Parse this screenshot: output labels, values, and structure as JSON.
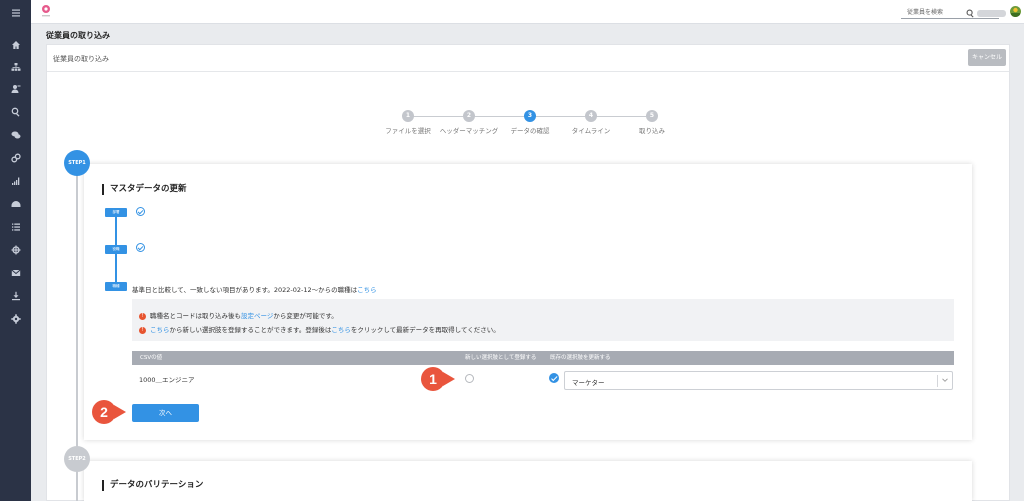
{
  "sidebar": {
    "icons": [
      "menu-icon",
      "home-icon",
      "org-chart-icon",
      "user-edit-icon",
      "search-icon",
      "chat-icon",
      "link-icon",
      "bar-chart-icon",
      "dashboard-icon",
      "list-icon",
      "target-icon",
      "mail-icon",
      "download-icon",
      "settings-icon"
    ]
  },
  "header": {
    "search_placeholder": "従業員を検索"
  },
  "page": {
    "title": "従業員の取り込み"
  },
  "panel": {
    "title": "従業員の取り込み",
    "cancel_label": "キャンセル"
  },
  "stepper": {
    "steps": [
      {
        "num": "1",
        "label": "ファイルを選択",
        "state": "done"
      },
      {
        "num": "2",
        "label": "ヘッダーマッチング",
        "state": "done"
      },
      {
        "num": "3",
        "label": "データの確認",
        "state": "active"
      },
      {
        "num": "4",
        "label": "タイムライン",
        "state": "todo"
      },
      {
        "num": "5",
        "label": "取り込み",
        "state": "todo"
      }
    ]
  },
  "step1": {
    "badge": "STEP1",
    "title": "マスタデータの更新",
    "tags": [
      "部署",
      "役職",
      "職種"
    ],
    "message_prefix": "基準日と比較して、一致しない項目があります。2022-02-12〜からの職種は",
    "message_link": "こちら",
    "notices": [
      {
        "num": "!",
        "pre": "職種名とコードは取り込み後も",
        "link": "設定ページ",
        "post": "から変更が可能です。"
      },
      {
        "num": "!",
        "pre": "",
        "link": "こちら",
        "post": "から新しい選択肢を登録することができます。登録後は",
        "link2": "こちら",
        "post2": "をクリックして最新データを再取得してください。"
      }
    ],
    "table": {
      "columns": [
        "CSVの値",
        "新しい選択肢として登録する",
        "既存の選択肢を更新する"
      ],
      "row": {
        "csv_value": "1000＿エンジニア",
        "select_value": "マーケター"
      }
    },
    "next_label": "次へ"
  },
  "step2": {
    "badge": "STEP2",
    "title": "データのバリテーション"
  },
  "callouts": [
    "1",
    "2"
  ],
  "colors": {
    "accent": "#3392e4",
    "callout": "#e9553d",
    "sidebar": "#2b3346"
  }
}
